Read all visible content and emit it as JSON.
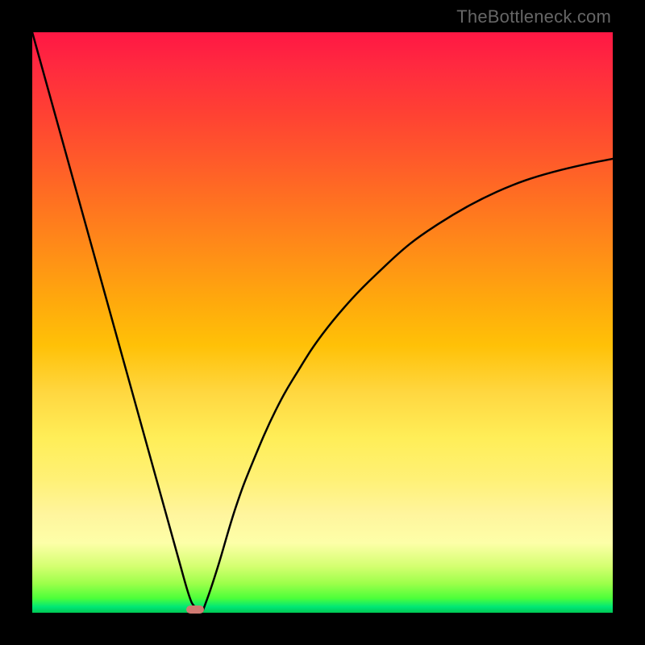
{
  "watermark": "TheBottleneck.com",
  "chart_data": {
    "type": "line",
    "title": "",
    "xlabel": "",
    "ylabel": "",
    "xlim": [
      0,
      100
    ],
    "ylim": [
      0,
      100
    ],
    "grid": false,
    "legend": false,
    "background_gradient": {
      "top_color": "#ff1744",
      "mid_colors": [
        "#ffa000",
        "#ffee58"
      ],
      "bottom_color": "#00c853"
    },
    "series": [
      {
        "name": "bottleneck-curve",
        "color": "#000000",
        "x": [
          0,
          5,
          10,
          15,
          20,
          25,
          27,
          28,
          29,
          30,
          32,
          35,
          38,
          42,
          46,
          50,
          55,
          60,
          65,
          70,
          75,
          80,
          85,
          90,
          95,
          100
        ],
        "values": [
          100,
          82,
          64,
          46,
          28,
          10,
          3,
          1,
          0,
          2,
          8,
          18,
          26,
          35,
          42,
          48,
          54,
          59,
          63.5,
          67,
          70,
          72.5,
          74.5,
          76,
          77.2,
          78.2
        ]
      }
    ],
    "marker": {
      "x": 28,
      "y": 0.5,
      "color": "#d07a72",
      "shape": "pill"
    }
  }
}
